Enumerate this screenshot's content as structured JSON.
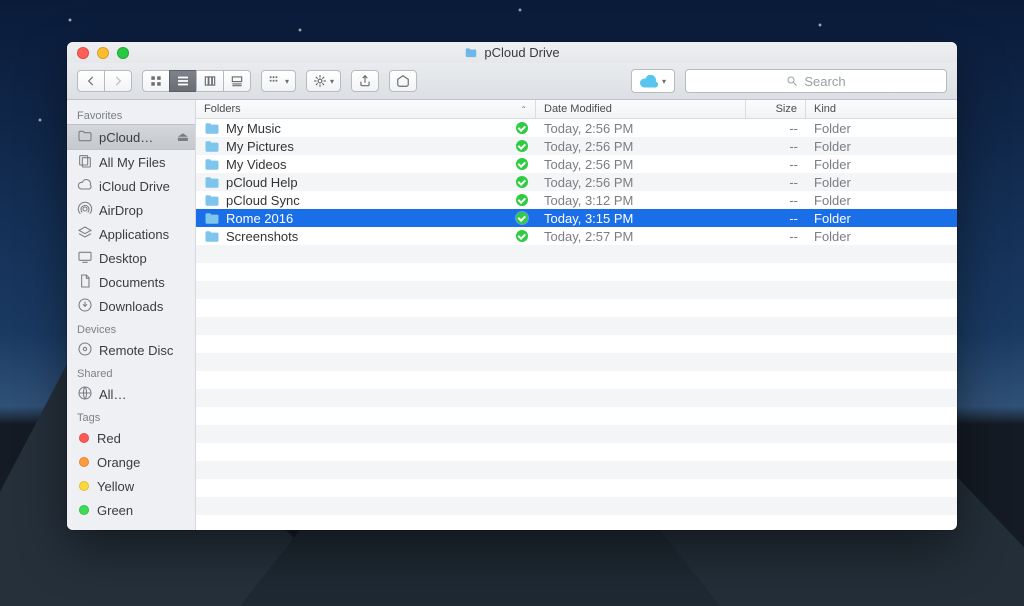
{
  "window": {
    "title": "pCloud Drive"
  },
  "toolbar": {
    "search_placeholder": "Search"
  },
  "sidebar": {
    "sections": {
      "favorites": "Favorites",
      "devices": "Devices",
      "shared": "Shared",
      "tags": "Tags"
    },
    "favorites": [
      {
        "label": "pCloud…",
        "icon": "folder",
        "selected": true,
        "ejectable": true
      },
      {
        "label": "All My Files",
        "icon": "allfiles"
      },
      {
        "label": "iCloud Drive",
        "icon": "cloud"
      },
      {
        "label": "AirDrop",
        "icon": "airdrop"
      },
      {
        "label": "Applications",
        "icon": "apps"
      },
      {
        "label": "Desktop",
        "icon": "desktop"
      },
      {
        "label": "Documents",
        "icon": "documents"
      },
      {
        "label": "Downloads",
        "icon": "downloads"
      }
    ],
    "devices": [
      {
        "label": "Remote Disc",
        "icon": "disc"
      }
    ],
    "shared": [
      {
        "label": "All…",
        "icon": "globe"
      }
    ],
    "tags": [
      {
        "label": "Red",
        "color": "#ff5a52"
      },
      {
        "label": "Orange",
        "color": "#ff9a3c"
      },
      {
        "label": "Yellow",
        "color": "#ffd93c"
      },
      {
        "label": "Green",
        "color": "#3cdc5a"
      }
    ]
  },
  "columns": {
    "name": "Folders",
    "date": "Date Modified",
    "size": "Size",
    "kind": "Kind"
  },
  "rows": [
    {
      "name": "My Music",
      "date": "Today, 2:56 PM",
      "size": "--",
      "kind": "Folder",
      "synced": true
    },
    {
      "name": "My Pictures",
      "date": "Today, 2:56 PM",
      "size": "--",
      "kind": "Folder",
      "synced": true
    },
    {
      "name": "My Videos",
      "date": "Today, 2:56 PM",
      "size": "--",
      "kind": "Folder",
      "synced": true
    },
    {
      "name": "pCloud Help",
      "date": "Today, 2:56 PM",
      "size": "--",
      "kind": "Folder",
      "synced": true
    },
    {
      "name": "pCloud Sync",
      "date": "Today, 3:12 PM",
      "size": "--",
      "kind": "Folder",
      "synced": true
    },
    {
      "name": "Rome 2016",
      "date": "Today, 3:15 PM",
      "size": "--",
      "kind": "Folder",
      "synced": true,
      "selected": true
    },
    {
      "name": "Screenshots",
      "date": "Today, 2:57 PM",
      "size": "--",
      "kind": "Folder",
      "synced": true
    }
  ]
}
